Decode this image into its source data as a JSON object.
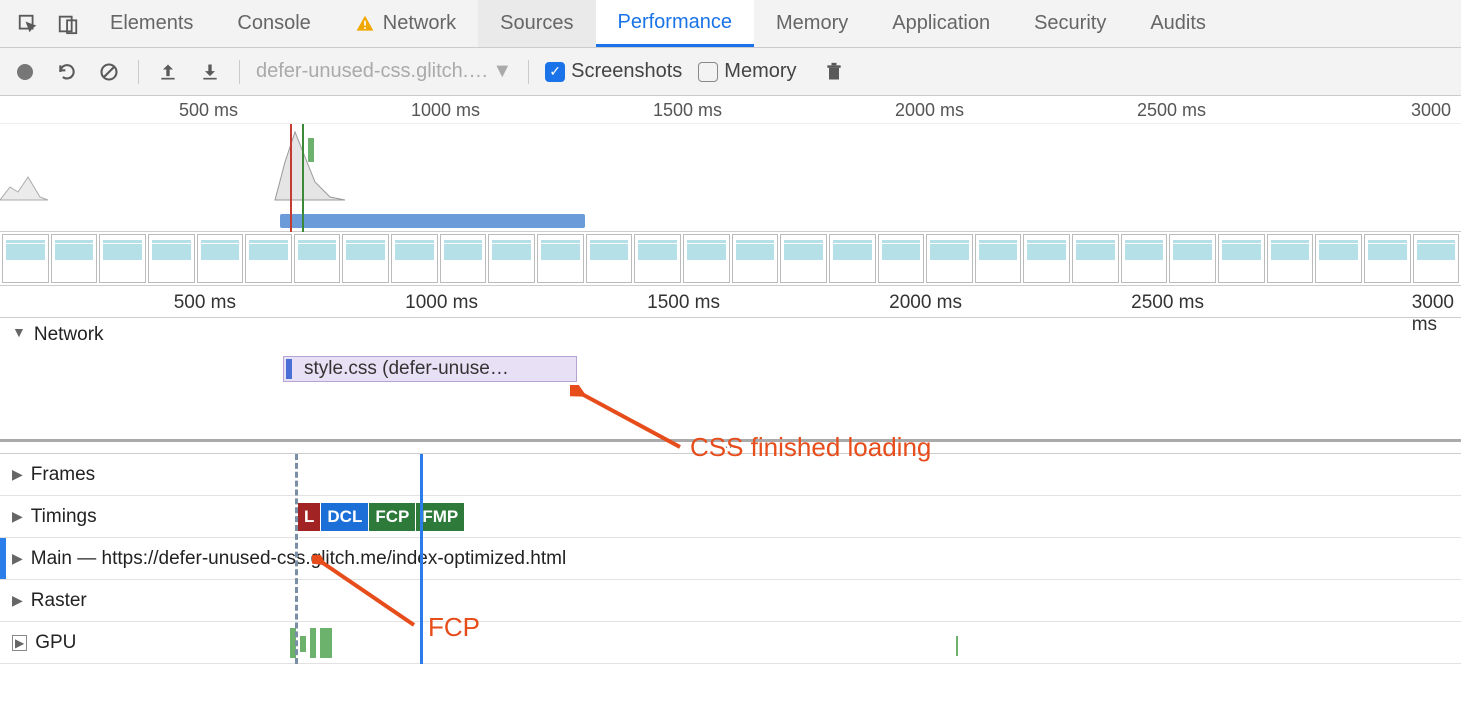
{
  "tabs": {
    "elements": "Elements",
    "console": "Console",
    "network": "Network",
    "sources": "Sources",
    "performance": "Performance",
    "memory": "Memory",
    "application": "Application",
    "security": "Security",
    "audits": "Audits"
  },
  "toolbar": {
    "profile_name": "defer-unused-css.glitch.…",
    "screenshots_label": "Screenshots",
    "memory_label": "Memory"
  },
  "overview_ruler": {
    "t1": "500 ms",
    "t2": "1000 ms",
    "t3": "1500 ms",
    "t4": "2000 ms",
    "t5": "2500 ms",
    "t6": "3000"
  },
  "main_ruler": {
    "t1": "500 ms",
    "t2": "1000 ms",
    "t3": "1500 ms",
    "t4": "2000 ms",
    "t5": "2500 ms",
    "t6": "3000 ms"
  },
  "tracks": {
    "network_label": "Network",
    "network_item": "style.css (defer-unuse…",
    "frames": "Frames",
    "timings": "Timings",
    "main": "Main — https://defer-unused-css.glitch.me/index-optimized.html",
    "raster": "Raster",
    "gpu": "GPU"
  },
  "timings": {
    "l": "L",
    "dcl": "DCL",
    "fcp": "FCP",
    "fmp": "FMP"
  },
  "annotations": {
    "css_loaded": "CSS finished loading",
    "fcp": "FCP"
  }
}
